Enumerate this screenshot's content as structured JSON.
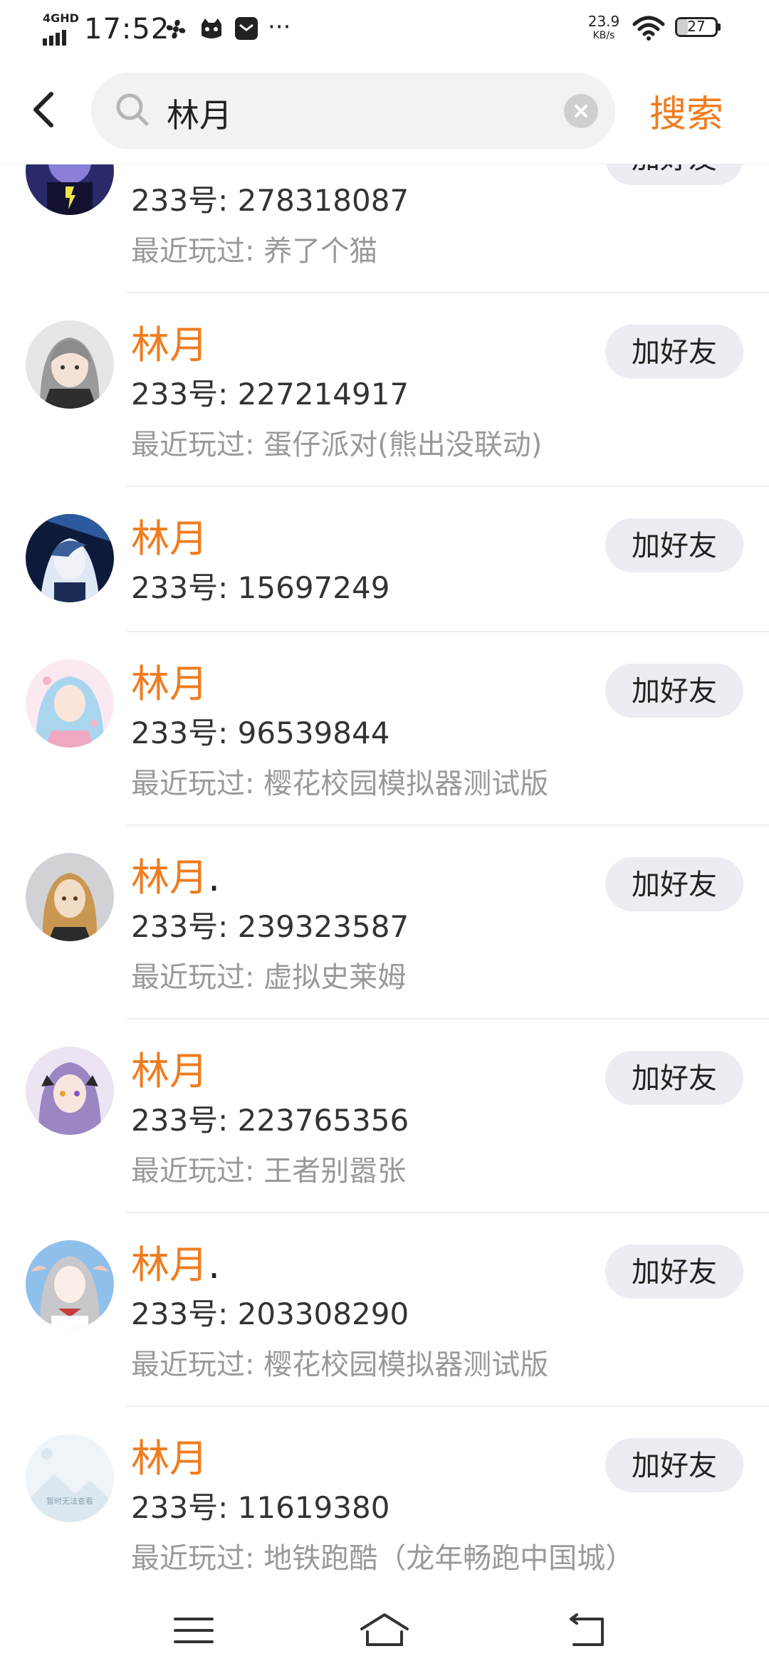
{
  "status_bar": {
    "network_label": "4GHD",
    "time": "17:52",
    "more_glyph": "···",
    "speed_value": "23.9",
    "speed_unit": "KB/s",
    "battery_level": "27",
    "battery_fraction": 0.27,
    "icons": [
      "fan-app-icon",
      "cat-app-icon",
      "mail-app-icon",
      "wifi-icon",
      "battery-icon"
    ]
  },
  "search": {
    "query": "林月",
    "button_label": "搜索"
  },
  "results": [
    {
      "name": "",
      "suffix": "",
      "id_line": "233号: 278318087",
      "recent": "最近玩过: 养了个猫",
      "button": "加好友"
    },
    {
      "name": "林月",
      "suffix": "",
      "id_line": "233号: 227214917",
      "recent": "最近玩过: 蛋仔派对(熊出没联动)",
      "button": "加好友"
    },
    {
      "name": "林月",
      "suffix": "",
      "id_line": "233号: 15697249",
      "recent": "",
      "button": "加好友"
    },
    {
      "name": "林月",
      "suffix": "",
      "id_line": "233号: 96539844",
      "recent": "最近玩过: 樱花校园模拟器测试版",
      "button": "加好友"
    },
    {
      "name": "林月",
      "suffix": ".",
      "id_line": "233号: 239323587",
      "recent": "最近玩过: 虚拟史莱姆",
      "button": "加好友"
    },
    {
      "name": "林月",
      "suffix": "",
      "id_line": "233号: 223765356",
      "recent": "最近玩过: 王者别嚣张",
      "button": "加好友"
    },
    {
      "name": "林月",
      "suffix": ".",
      "id_line": "233号: 203308290",
      "recent": "最近玩过: 樱花校园模拟器测试版",
      "button": "加好友"
    },
    {
      "name": "林月",
      "suffix": "",
      "id_line": "233号: 11619380",
      "recent": "最近玩过: 地铁跑酷（龙年畅跑中国城）",
      "button": "加好友",
      "avatar_placeholder": "暂时无法查看"
    }
  ],
  "colors": {
    "accent": "#f07c1e",
    "button_bg": "#ececf3",
    "secondary_text": "#999999"
  }
}
